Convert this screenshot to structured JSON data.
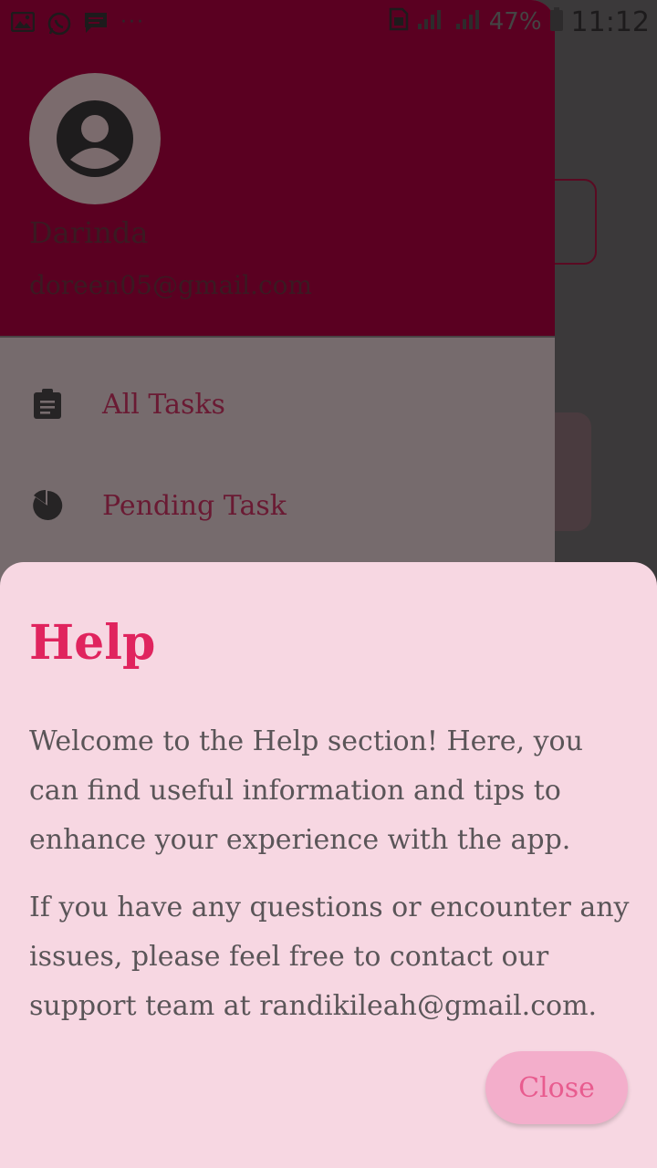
{
  "status_bar": {
    "icons": [
      "gallery-icon",
      "whatsapp-icon",
      "message-icon",
      "more-icon"
    ],
    "more_dots": "···",
    "battery_percent": "47%",
    "time": "11:12"
  },
  "drawer": {
    "user": {
      "name": "Darinda",
      "email": "doreen05@gmail.com"
    },
    "items": [
      {
        "icon": "clipboard-icon",
        "label": "All Tasks"
      },
      {
        "icon": "pie-chart-icon",
        "label": "Pending Task"
      }
    ]
  },
  "dialog": {
    "title": "Help",
    "paragraphs": [
      "Welcome to the Help section! Here, you can find useful information and tips to enhance your experience with the app.",
      "If you have any questions or encounter any issues, please feel free to contact our support team at randikileah@gmail.com."
    ],
    "close_label": "Close"
  },
  "colors": {
    "header": "#5a0021",
    "dialog_bg": "#f7d7e2",
    "title": "#e0245e",
    "close_button_bg": "#f3aecb",
    "close_button_text": "#e85c8f"
  }
}
